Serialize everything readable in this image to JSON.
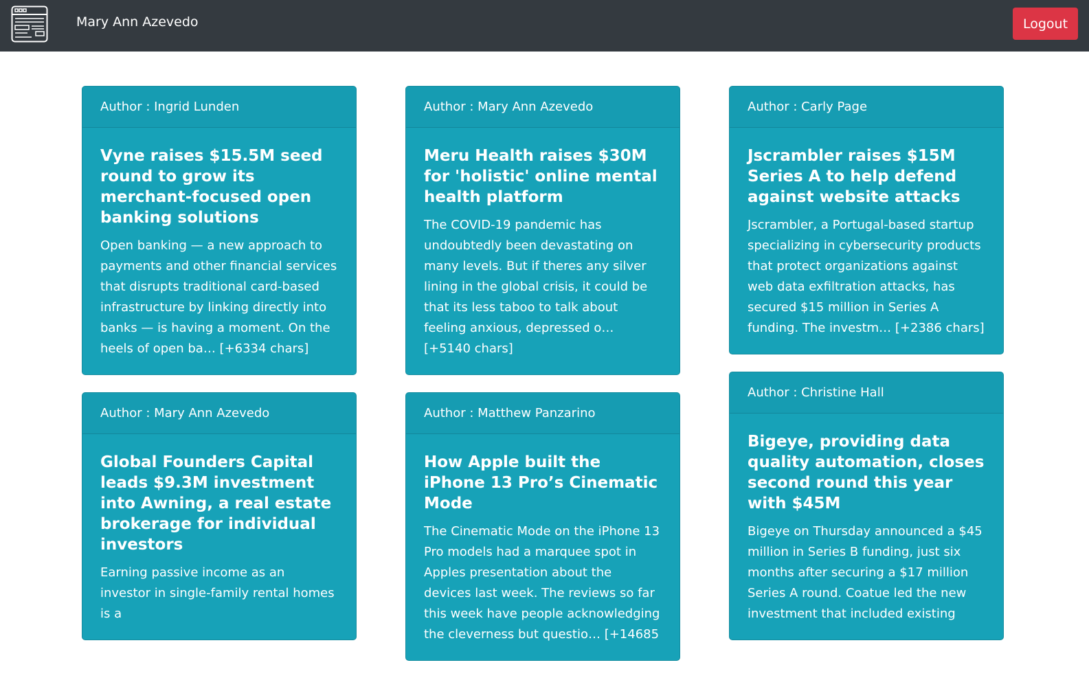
{
  "navbar": {
    "username": "Mary Ann Azevedo",
    "logout_label": "Logout"
  },
  "colors": {
    "navbar": "#343a40",
    "card": "#17a2b8",
    "logout": "#dc3545"
  },
  "columns": [
    [
      {
        "author": "Author : Ingrid Lunden",
        "title": "Vyne raises $15.5M seed round to grow its merchant-focused open banking solutions",
        "text": "Open banking — a new approach to payments and other financial services that disrupts traditional card-based infrastructure by linking directly into banks — is having a moment. On the heels of open ba… [+6334 chars]"
      },
      {
        "author": "Author : Mary Ann Azevedo",
        "title": "Global Founders Capital leads $9.3M investment into Awning, a real estate brokerage for individual investors",
        "text": "Earning passive income as an investor in single-family rental homes is a"
      }
    ],
    [
      {
        "author": "Author : Mary Ann Azevedo",
        "title": "Meru Health raises $30M for 'holistic' online mental health platform",
        "text": "The COVID-19 pandemic has undoubtedly been devastating on many levels. But if theres any silver lining in the global crisis, it could be that its less taboo to talk about feeling anxious, depressed o… [+5140 chars]"
      },
      {
        "author": "Author : Matthew Panzarino",
        "title": "How Apple built the iPhone 13 Pro’s Cinematic Mode",
        "text": "The Cinematic Mode on the iPhone 13 Pro models had a marquee spot in Apples presentation about the devices last week. The reviews so far this week have people acknowledging the cleverness but questio… [+14685"
      }
    ],
    [
      {
        "author": "Author : Carly Page",
        "title": "Jscrambler raises $15M Series A to help defend against website attacks",
        "text": "Jscrambler, a Portugal-based startup specializing in cybersecurity products that protect organizations against web data exfiltration attacks, has secured $15 million in Series A funding. The investm… [+2386 chars]"
      },
      {
        "author": "Author : Christine Hall",
        "title": "Bigeye, providing data quality automation, closes second round this year with $45M",
        "text": "Bigeye on Thursday announced a $45 million in Series B funding, just six months after securing a $17 million Series A round. Coatue led the new investment that included existing"
      }
    ]
  ]
}
